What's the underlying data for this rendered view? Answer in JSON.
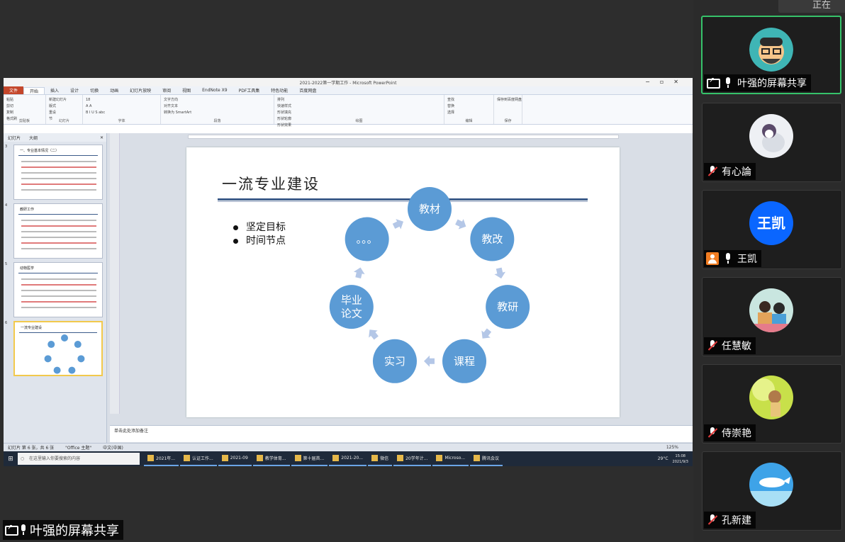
{
  "ppt": {
    "window_title": "2021-2022第一学期工作 - Microsoft PowerPoint",
    "tabs": [
      "文件",
      "开始",
      "插入",
      "设计",
      "切换",
      "动画",
      "幻灯片放映",
      "审阅",
      "视图",
      "EndNote X9",
      "PDF工具集",
      "特色功能",
      "百度网盘"
    ],
    "ribbon": {
      "groups": [
        {
          "label": "剪贴板",
          "items": [
            "粘贴",
            "剪切",
            "复制",
            "格式刷"
          ]
        },
        {
          "label": "幻灯片",
          "items": [
            "新建幻灯片",
            "版式",
            "重设",
            "节"
          ]
        },
        {
          "label": "字体",
          "items": [
            "18",
            "A A",
            "B I U S abc"
          ]
        },
        {
          "label": "段落",
          "items": [
            "文字方向",
            "对齐文本",
            "转换为 SmartArt"
          ]
        },
        {
          "label": "绘图",
          "items": [
            "排列",
            "快速样式",
            "形状填充",
            "形状轮廓",
            "形状效果"
          ]
        },
        {
          "label": "编辑",
          "items": [
            "查找",
            "替换",
            "选择"
          ]
        },
        {
          "label": "保存",
          "items": [
            "保存到百度网盘"
          ]
        }
      ]
    },
    "thumb_tabs": [
      "幻灯片",
      "大纲"
    ],
    "thumbnails": [
      {
        "num": "3",
        "title": "一、专业基本情况（二）"
      },
      {
        "num": "4",
        "title": "教研工作"
      },
      {
        "num": "5",
        "title": "动物医学"
      },
      {
        "num": "6",
        "title": "一流专业建设",
        "selected": true
      }
    ],
    "slide": {
      "title": "一流专业建设",
      "bullets": [
        "坚定目标",
        "时间节点"
      ],
      "cycle": [
        {
          "label": "教材"
        },
        {
          "label": "教改"
        },
        {
          "label": "教研"
        },
        {
          "label": "课程"
        },
        {
          "label": "实习"
        },
        {
          "label": "毕业\n论文"
        },
        {
          "label": "。。。"
        }
      ],
      "node_color": "#5b9bd5",
      "arrow_color": "#b4c7e7"
    },
    "notes_placeholder": "单击此处添加备注",
    "status": {
      "slide_info": "幻灯片 第 6 张，共 6 张",
      "theme": "\"Office 主题\"",
      "lang": "中文(中国)",
      "zoom": "125%"
    }
  },
  "taskbar": {
    "search_placeholder": "在这里输入你要搜索的内容",
    "apps": [
      "2021年...",
      "认证工作...",
      "2021-09",
      "教学体育...",
      "第十届首...",
      "2021-20...",
      "微信",
      "20学年计...",
      "Microso...",
      "腾讯会议"
    ],
    "weather": "29°C",
    "time": "15:08",
    "date": "2021/9/3"
  },
  "share_label": "叶强的屏幕共享",
  "participants": [
    {
      "name": "叶强的屏幕共享",
      "status": "screen",
      "mic": "on",
      "avatar": "cartoon-man",
      "speaking": true
    },
    {
      "name": "有心論",
      "status": "none",
      "mic": "muted",
      "avatar": "cat-figurine"
    },
    {
      "name": "王凯",
      "status": "user",
      "mic": "on",
      "avatar": "letters",
      "letters": "王凯"
    },
    {
      "name": "任慧敏",
      "status": "none",
      "mic": "muted",
      "avatar": "kids-photo"
    },
    {
      "name": "侍崇艳",
      "status": "none",
      "mic": "muted",
      "avatar": "flower-girl"
    },
    {
      "name": "孔新建",
      "status": "none",
      "mic": "muted",
      "avatar": "whale-sky"
    }
  ],
  "topbar_text": "正在"
}
